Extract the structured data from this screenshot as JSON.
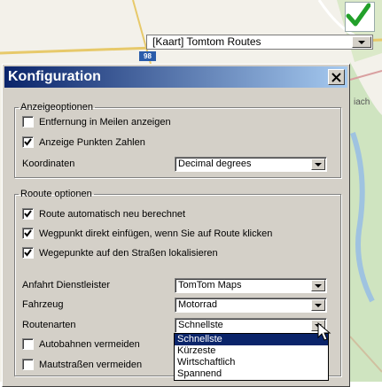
{
  "map": {
    "layer_select_value": "[Kaart] Tomtom Routes",
    "road_badge": "98",
    "place_fragment": "iach",
    "confirm_icon": "check-icon"
  },
  "dialog": {
    "title": "Konfiguration",
    "display_group": {
      "legend": "Anzeigeoptionen",
      "miles": {
        "label": "Entfernung in Meilen anzeigen",
        "checked": false
      },
      "points": {
        "label": "Anzeige Punkten Zahlen",
        "checked": true
      },
      "coords_label": "Koordinaten",
      "coords_value": "Decimal degrees"
    },
    "route_group": {
      "legend": "Rooute optionen",
      "recalc": {
        "label": "Route automatisch neu berechnet",
        "checked": true
      },
      "insert_wp": {
        "label": "Wegpunkt direkt einfügen, wenn Sie auf Route klicken",
        "checked": true
      },
      "locate_wp": {
        "label": "Wegepunkte auf den Straßen lokalisieren",
        "checked": true
      },
      "provider_label": "Anfahrt Dienstleister",
      "provider_value": "TomTom Maps",
      "vehicle_label": "Fahrzeug",
      "vehicle_value": "Motorrad",
      "routetype_label": "Routenarten",
      "routetype_value": "Schnellste",
      "avoid_highways": {
        "label": "Autobahnen vermeiden",
        "checked": false
      },
      "avoid_tolls": {
        "label": "Mautstraßen vermeiden",
        "checked": false
      }
    },
    "routetype_options": [
      "Schnellste",
      "Kürzeste",
      "Wirtschaftlich",
      "Spannend"
    ],
    "routetype_selected_index": 0
  }
}
